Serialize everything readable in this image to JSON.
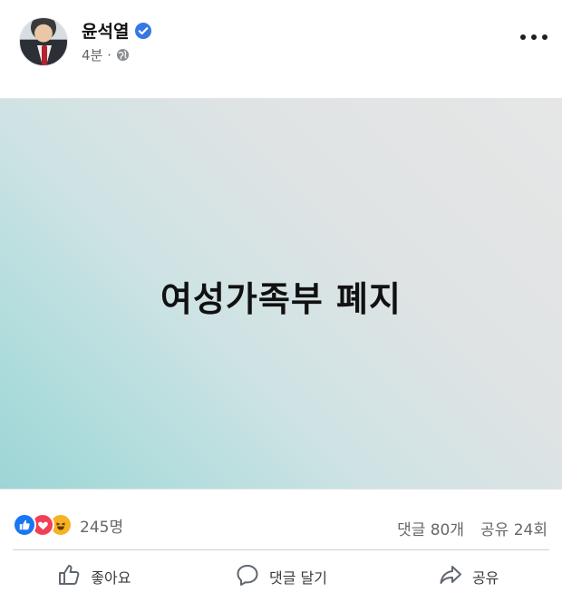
{
  "post": {
    "author_name": "윤석열",
    "time": "4분 ·",
    "headline": "여성가족부 폐지"
  },
  "stats": {
    "reaction_count": "245명",
    "comments": "댓글 80개",
    "shares": "공유 24회"
  },
  "actions": {
    "like_label": "좋아요",
    "comment_label": "댓글 달기",
    "share_label": "공유"
  },
  "icons": {
    "verified": "verified-badge-icon",
    "privacy": "globe-icon",
    "more": "more-options-icon",
    "like": "thumbs-up-icon",
    "comment": "speech-bubble-icon",
    "share": "share-arrow-icon"
  },
  "colors": {
    "verified": "#3578e5",
    "like": "#1877f2",
    "love": "#f33e58",
    "haha": "#f7b125"
  }
}
